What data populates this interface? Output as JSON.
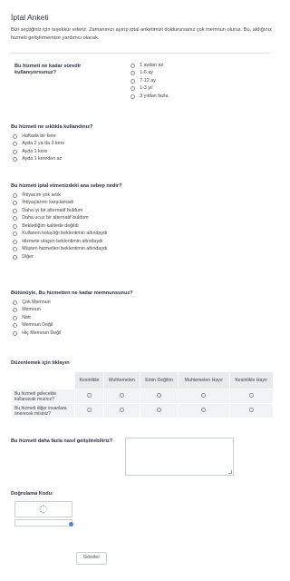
{
  "form": {
    "title": "İptal Anketi",
    "description": "Bizi seçtiğiniz için teşekkür ederiz. Zamanınızı ayırıp iptal anketimizi doldurursanız çok memnun oluruz. Bu, aldığınız hizmeti geliştirmemize yardımcı olacak."
  },
  "q1": {
    "label": "Bu hizmeti ne kadar süredir kullanıyorsunuz?",
    "options": [
      "1 aydan az",
      "1-6 ay",
      "7-12 ay",
      "1-3 yıl",
      "3 yıldan fazla"
    ]
  },
  "q2": {
    "label": "Bu hizmeti ne sıklıkla kullandınız?",
    "options": [
      "Haftada bir kere",
      "Ayda 2 ya da 3 kere",
      "Ayda 1 kere",
      "Ayda 1 kereden az"
    ]
  },
  "q3": {
    "label": "Bu hizmeti iptal etmenizdeki ana sebep nedir?",
    "options": [
      "İhtiyacım yok artık",
      "İhtiyaçlarımı karşılamadı",
      "Daha iyi bir alternatif buldum",
      "Daha ucuz bir alternatif buldum",
      "Beklediğim kalitede değildi",
      "Kullanım kolaylığı beklentimin altındaydı",
      "Hizmete ulaşım beklentimin altındaydı",
      "Müşteri hizmetleri beklentimin altındaydı",
      "Diğer"
    ]
  },
  "q4": {
    "label": "Bütünüyle, Bu hizmetten ne kadar memnunsunuz?",
    "options": [
      "Çok Memnun",
      "Memnun",
      "Nötr",
      "Memnun Değil",
      "Hiç Memnun Değil"
    ]
  },
  "q5": {
    "label": "Düzenlemek için tıklayın",
    "columns": [
      "Kesinlikle",
      "Muhtemelen",
      "Emin Değilim",
      "Muhtemelen Hayır",
      "Kesinlikle Hayır"
    ],
    "rows": [
      "Bu hizmeti gelecekte kullanacak mısınız?",
      "Bu hizmeti diğer insanlara önerecek misiniz?"
    ]
  },
  "q6": {
    "label": "Bu hizmeti daha fazla nasıl geliştirebiliriz?"
  },
  "captcha": {
    "label": "Doğrulama Kodu:"
  },
  "submit": {
    "label": "Gönder"
  }
}
